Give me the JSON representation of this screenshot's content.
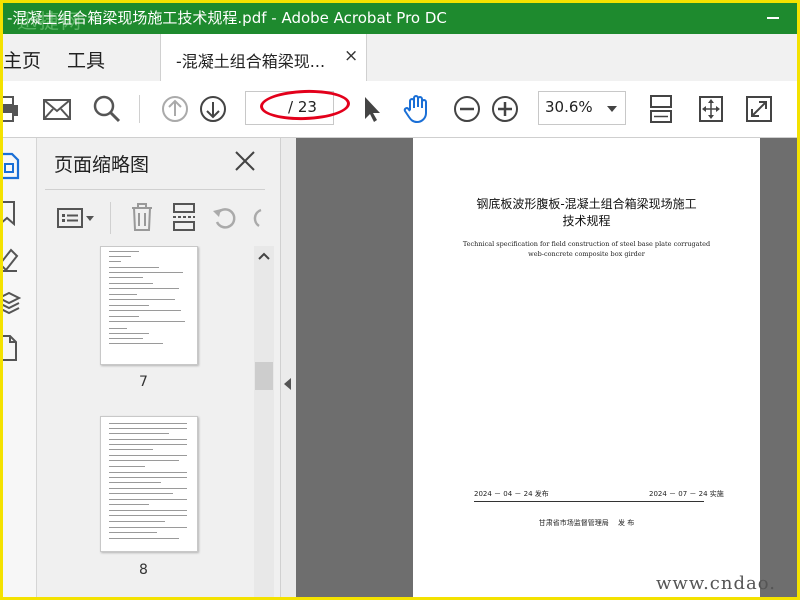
{
  "window": {
    "title": "-混凝土组合箱梁现场施工技术规程.pdf - Adobe Acrobat Pro DC",
    "watermark": "迅捷网"
  },
  "tabs": {
    "home": "主页",
    "tools": "工具",
    "document": "-混凝土组合箱梁现...",
    "close": "×"
  },
  "toolbar": {
    "page_current": "",
    "page_total": "/ 23",
    "zoom": "30.6%"
  },
  "thumbnail_panel": {
    "title": "页面缩略图",
    "pages": [
      {
        "number": "7"
      },
      {
        "number": "8"
      }
    ]
  },
  "document": {
    "title_line1": "钢底板波形腹板-混凝土组合箱梁现场施工",
    "title_line2": "技术规程",
    "english_line1": "Technical specification for field construction of steel base plate corrugated",
    "english_line2": "web-concrete composite box girder",
    "issue_date": "2024 － 04 － 24 发布",
    "implement_date": "2024 － 07 － 24 实施",
    "issuer": "甘肃省市场监督管理局　 发 布"
  },
  "site_watermark": "www.cndao.",
  "colors": {
    "titlebar": "#1e8a2e",
    "accent_blue": "#1a6fd6",
    "annotation_red": "#e3001b",
    "frame_yellow": "#f4e200"
  }
}
